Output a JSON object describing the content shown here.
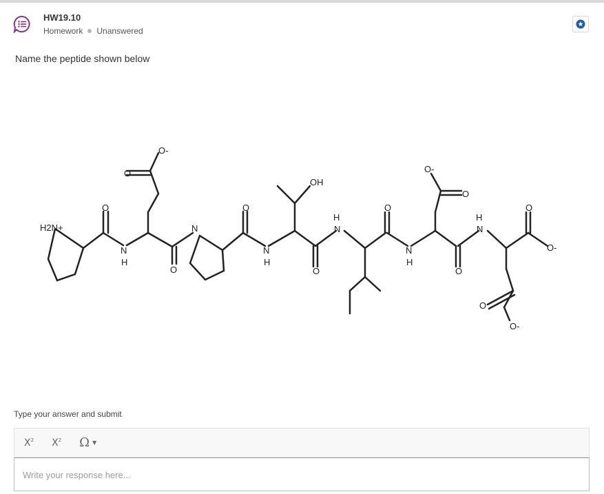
{
  "header": {
    "title": "HW19.10",
    "category": "Homework",
    "status": "Unanswered",
    "icon": "question-list-icon",
    "action_icon": "star-bookmark-icon",
    "accent": "#8a2e8f",
    "action_color": "#1d5fa8"
  },
  "question": {
    "prompt": "Name the peptide shown below"
  },
  "structure": {
    "labels": {
      "amine": "H2N+",
      "n": "N",
      "h": "H",
      "o": "O",
      "o_minus": "O-",
      "oh": "OH"
    }
  },
  "answer": {
    "instruction": "Type your answer and submit",
    "toolbar": {
      "subscript": "X",
      "superscript": "X",
      "special_chars": "Ω"
    },
    "placeholder": "Write your response here..."
  }
}
